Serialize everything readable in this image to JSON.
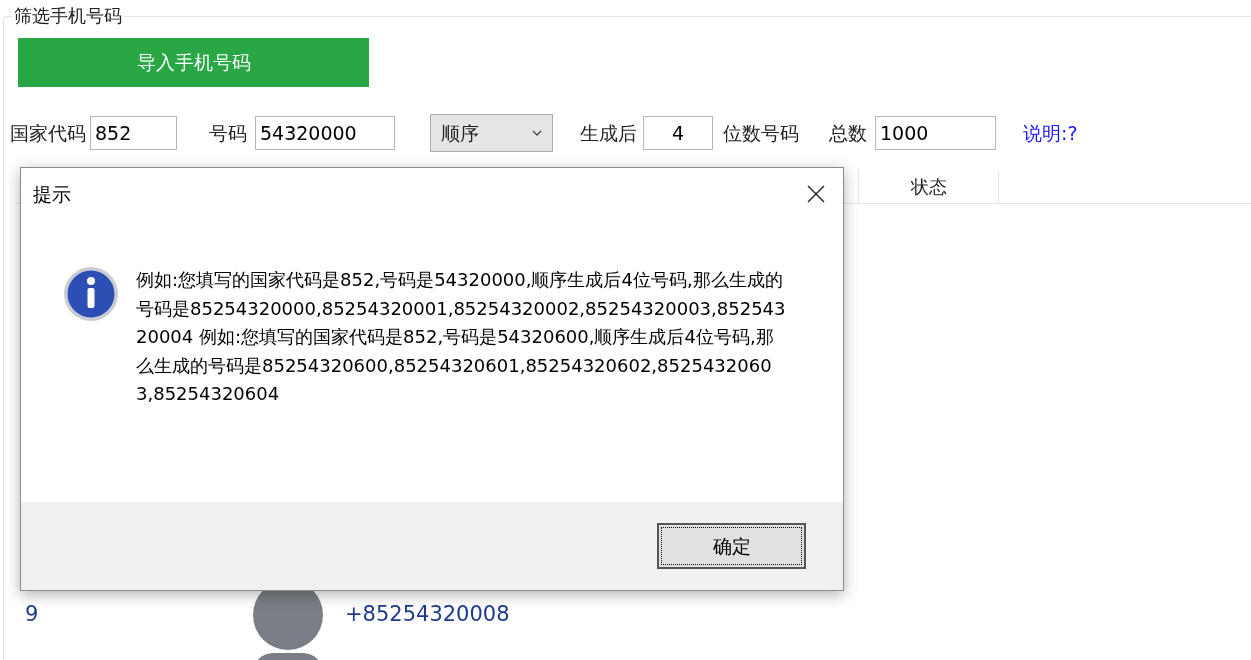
{
  "group": {
    "title": "筛选手机号码"
  },
  "import_button": "导入手机号码",
  "filters": {
    "country_code_label": "国家代码",
    "country_code": "852",
    "number_label": "号码",
    "number": "54320000",
    "order": "顺序",
    "after_label": "生成后",
    "digits": "4",
    "digits_label": "位数号码",
    "total_label": "总数",
    "total": "1000",
    "help_link": "说明:?"
  },
  "table": {
    "columns": [
      {
        "label": "状态"
      }
    ],
    "rows": [
      {
        "index": "9",
        "phone": "+85254320008"
      }
    ]
  },
  "dialog": {
    "title": "提示",
    "message": "例如:您填写的国家代码是852,号码是54320000,顺序生成后4位号码,那么生成的号码是85254320000,85254320001,85254320002,85254320003,85254320004 例如:您填写的国家代码是852,号码是54320600,顺序生成后4位号码,那么生成的号码是85254320600,85254320601,85254320602,85254320603,85254320604",
    "ok_button": "确定"
  }
}
